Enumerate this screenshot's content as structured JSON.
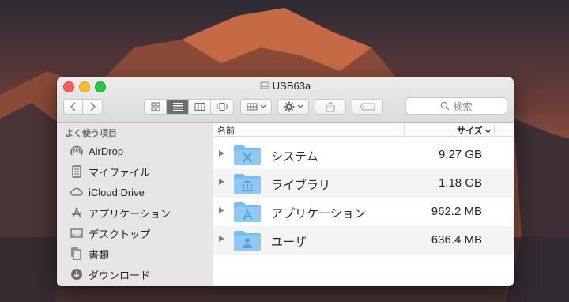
{
  "window": {
    "title": "USB63a"
  },
  "toolbar": {
    "view_modes": [
      "icon-view",
      "list-view",
      "column-view",
      "cover-flow-view"
    ],
    "active_view": "list-view",
    "search_placeholder": "検索"
  },
  "sidebar": {
    "heading": "よく使う項目",
    "items": [
      {
        "label": "AirDrop",
        "icon": "airdrop-icon"
      },
      {
        "label": "マイファイル",
        "icon": "all-my-files-icon"
      },
      {
        "label": "iCloud Drive",
        "icon": "cloud-icon"
      },
      {
        "label": "アプリケーション",
        "icon": "applications-icon"
      },
      {
        "label": "デスクトップ",
        "icon": "desktop-icon"
      },
      {
        "label": "書類",
        "icon": "documents-icon"
      },
      {
        "label": "ダウンロード",
        "icon": "download-icon"
      }
    ]
  },
  "list": {
    "col_name": "名前",
    "col_size": "サイズ",
    "rows": [
      {
        "name": "システム",
        "size": "9.27 GB",
        "icon": "system-folder-icon"
      },
      {
        "name": "ライブラリ",
        "size": "1.18 GB",
        "icon": "library-folder-icon"
      },
      {
        "name": "アプリケーション",
        "size": "962.2 MB",
        "icon": "applications-folder-icon"
      },
      {
        "name": "ユーザ",
        "size": "636.4 MB",
        "icon": "users-folder-icon"
      }
    ]
  },
  "colors": {
    "folder": "#7cbdef",
    "accent": "#28c840"
  }
}
